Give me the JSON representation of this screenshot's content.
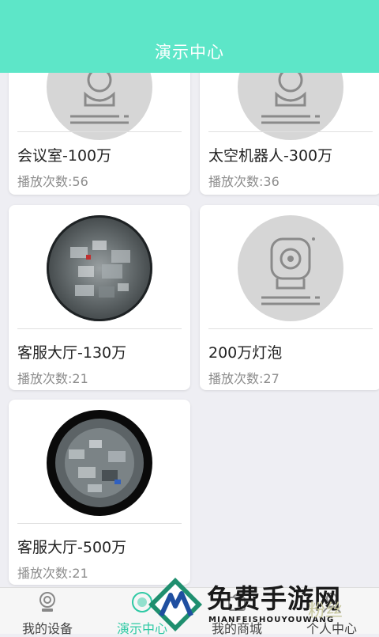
{
  "header": {
    "title": "演示中心"
  },
  "cards": [
    {
      "name": "会议室-100万",
      "plays": "播放次数:56",
      "thumb": "camera-placeholder"
    },
    {
      "name": "太空机器人-300万",
      "plays": "播放次数:36",
      "thumb": "camera-placeholder"
    },
    {
      "name": "客服大厅-130万",
      "plays": "播放次数:21",
      "thumb": "fisheye-office"
    },
    {
      "name": "200万灯泡",
      "plays": "播放次数:27",
      "thumb": "camera-placeholder"
    },
    {
      "name": "客服大厅-500万",
      "plays": "播放次数:21",
      "thumb": "fisheye-office-dark"
    }
  ],
  "tabbar": {
    "active_index": 1,
    "tabs": [
      {
        "label": "我的设备",
        "icon": "camera-icon"
      },
      {
        "label": "演示中心",
        "icon": "play-icon"
      },
      {
        "label": "我的商城",
        "icon": "shop-icon"
      },
      {
        "label": "个人中心",
        "icon": "person-icon"
      }
    ]
  },
  "watermark": {
    "cn": "免费手游网",
    "en": "MIANFEISHOUYOUWANG",
    "extra": "粉丝"
  },
  "colors": {
    "accent": "#5de6c8",
    "active_tab": "#2ec9a4"
  }
}
